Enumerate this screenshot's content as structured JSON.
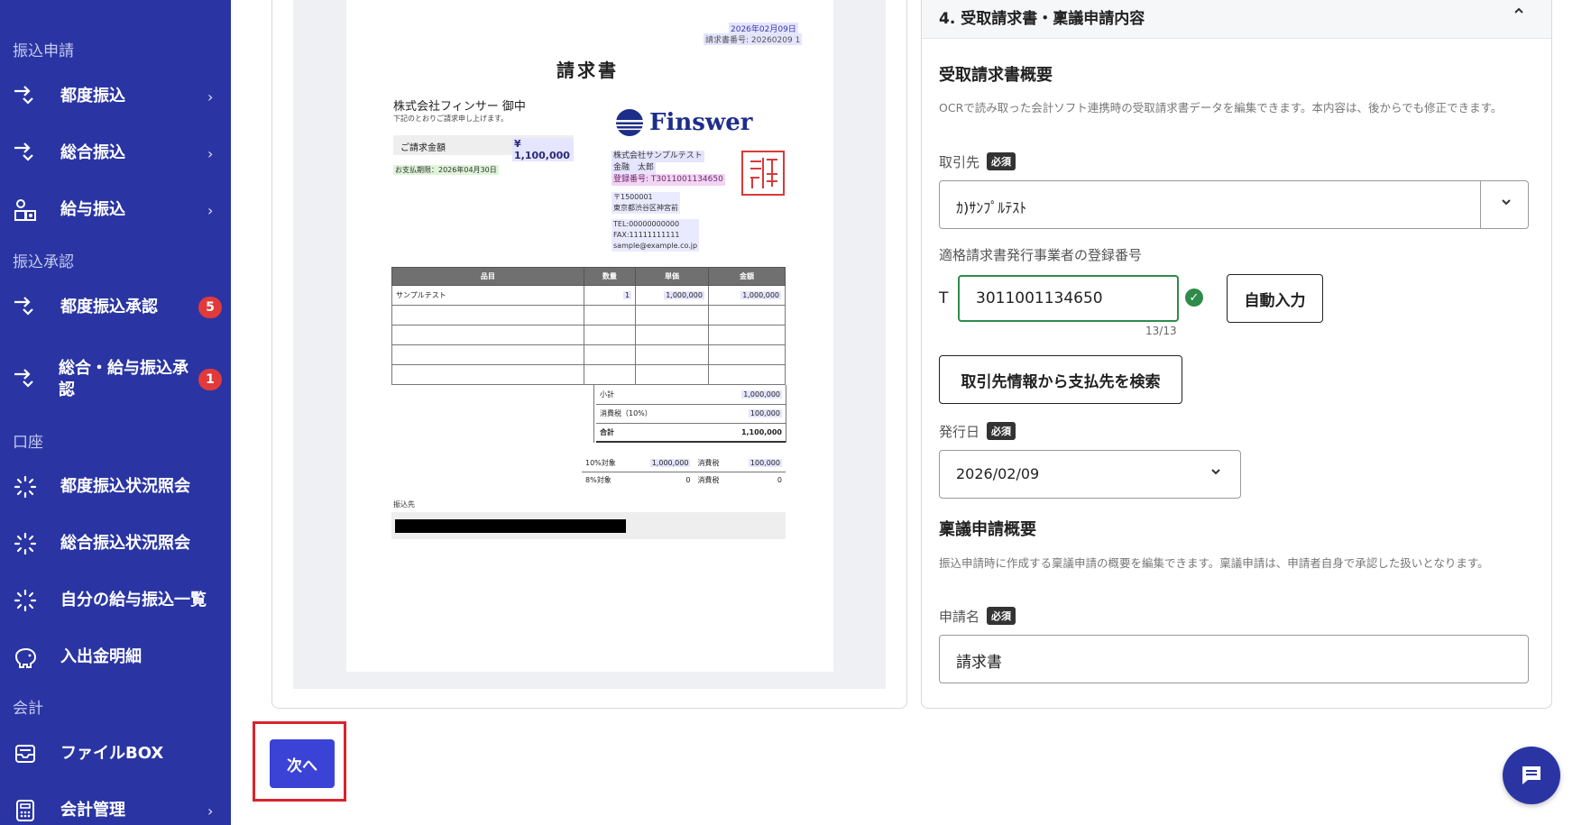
{
  "sidebar": {
    "sections": {
      "transfer_request": "振込申請",
      "transfer_approval": "振込承認",
      "account": "口座",
      "accounting": "会計"
    },
    "items": [
      {
        "label": "都度振込",
        "icon": "arrow-transfer-icon"
      },
      {
        "label": "総合振込",
        "icon": "arrow-transfer-icon"
      },
      {
        "label": "給与振込",
        "icon": "payroll-icon"
      },
      {
        "label": "都度振込承認",
        "icon": "arrow-transfer-icon",
        "badge": "5"
      },
      {
        "label": "総合・給与振込承認",
        "icon": "arrow-transfer-icon",
        "badge": "1"
      },
      {
        "label": "都度振込状況照会",
        "icon": "loading-spinner-icon"
      },
      {
        "label": "総合振込状況照会",
        "icon": "loading-spinner-icon"
      },
      {
        "label": "自分の給与振込一覧",
        "icon": "loading-spinner-icon"
      },
      {
        "label": "入出金明細",
        "icon": "piggy-bank-icon"
      },
      {
        "label": "ファイルBOX",
        "icon": "inbox-icon"
      },
      {
        "label": "会計管理",
        "icon": "calculator-icon"
      }
    ]
  },
  "invoice": {
    "date": "2026年02月09日",
    "number": "請求書番号: 20260209 1",
    "title": "請求書",
    "recipient": "株式会社フィンサー 御中",
    "recipient_note": "下記のとおりご請求申し上げます。",
    "amount_label": "ご請求金額",
    "amount_value": "¥ 1,100,000",
    "due": "お支払期限：2026年04月30日",
    "logo_text": "Finswer",
    "issuer_company": "株式会社サンプルテスト",
    "issuer_person": "金融　太郎",
    "issuer_reg": "登録番号: T3011001134650",
    "postal": "〒1500001",
    "address": "東京都渋谷区神宮前",
    "tel": "TEL:00000000000",
    "fax": "FAX:11111111111",
    "email": "sample@example.co.jp",
    "seal_text": "株式会社サンプルテスト",
    "table_headers": [
      "品目",
      "数量",
      "単価",
      "金額"
    ],
    "rows": [
      {
        "item": "サンプルテスト",
        "qty": "1",
        "unit": "1,000,000",
        "amount": "1,000,000"
      }
    ],
    "subtotal_label": "小計",
    "subtotal_value": "1,000,000",
    "tax_label": "消費税（10%）",
    "tax_value": "100,000",
    "total_label": "合計",
    "total_value": "1,100,000",
    "tax_rows": [
      {
        "label": "10%対象",
        "base": "1,000,000",
        "tax_label": "消費税",
        "tax": "100,000"
      },
      {
        "label": "8%対象",
        "base": "0",
        "tax_label": "消費税",
        "tax": "0"
      }
    ],
    "bank_label": "振込先"
  },
  "form": {
    "section_title": "4. 受取請求書・稟議申請内容",
    "invoice_summary_title": "受取請求書概要",
    "invoice_summary_desc": "OCRで読み取った会計ソフト連携時の受取請求書データを編集できます。本内容は、後からでも修正できます。",
    "partner_label": "取引先",
    "required": "必須",
    "partner_value": "ｶ)ｻﾝﾌﾟﾙﾃｽﾄ",
    "reg_label": "適格請求書発行事業者の登録番号",
    "reg_prefix": "T",
    "reg_value": "3011001134650",
    "reg_counter": "13/13",
    "auto_fill": "自動入力",
    "search_btn": "取引先情報から支払先を検索",
    "issue_date_label": "発行日",
    "issue_date_value": "2026/02/09",
    "approval_title": "稟議申請概要",
    "approval_desc": "振込申請時に作成する稟議申請の概要を編集できます。稟議申請は、申請者自身で承認した扱いとなります。",
    "application_label": "申請名",
    "application_value": "請求書"
  },
  "footer": {
    "next": "次へ"
  },
  "colors": {
    "sidebar": "#2a35a3",
    "primary": "#3a43d6",
    "badge": "#e23a3a",
    "success": "#2e8b4a",
    "highlight_frame": "#d9232c"
  }
}
